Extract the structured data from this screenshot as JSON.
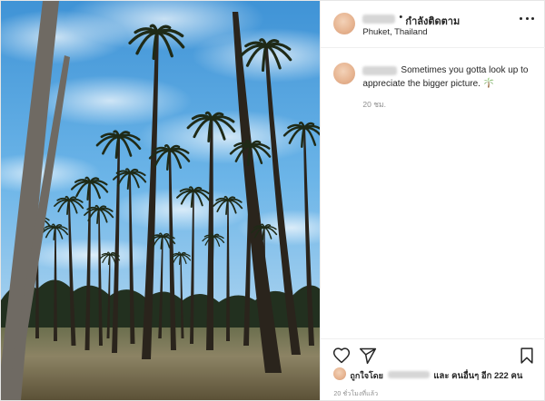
{
  "post": {
    "photo": {
      "alt": "Tall coconut palm trees against a blue sky with white clouds"
    },
    "header": {
      "separator": "•",
      "follow_label": "กำลังติดตาม",
      "location": "Phuket, Thailand",
      "more_icon": "more-options-icon"
    },
    "caption": {
      "text": "Sometimes you gotta look up to appreciate the bigger picture.",
      "emoji": "palm-tree-icon",
      "time": "20 ชม."
    },
    "actions": {
      "like_icon": "heart-icon",
      "share_icon": "paper-plane-icon",
      "save_icon": "bookmark-icon"
    },
    "likes": {
      "prefix": "ถูกใจโดย",
      "suffix": "และ คนอื่นๆ อีก 222 คน"
    },
    "date": "20 ชั่วโมงที่แล้ว"
  },
  "colors": {
    "text": "#262626",
    "muted": "#8e8e8e",
    "divider": "#efefef",
    "sky": "#6fb6e8"
  }
}
